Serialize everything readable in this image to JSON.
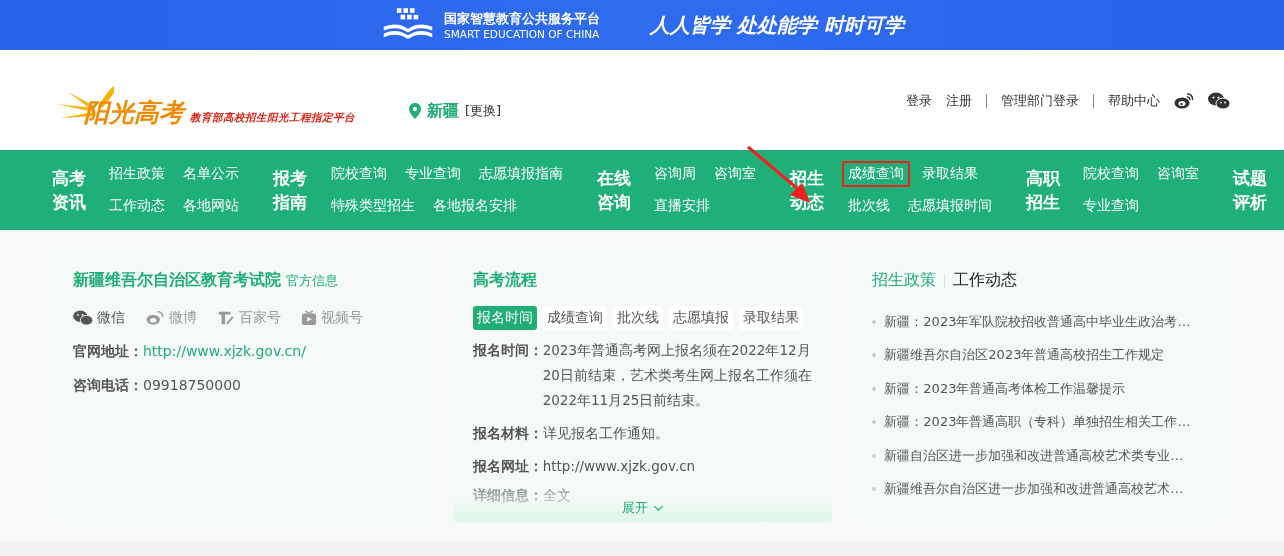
{
  "banner": {
    "platform_name": "国家智慧教育公共服务平台",
    "platform_name_en": "SMART EDUCATION OF CHINA",
    "slogan": "人人皆学 处处能学 时时可学"
  },
  "header": {
    "logo_text": "阳光高考",
    "logo_subtitle": "教育部高校招生阳光工程指定平台",
    "location": "新疆",
    "change_link": "[更换]",
    "link_groups": [
      [
        "登录",
        "注册"
      ],
      [
        "管理部门登录"
      ],
      [
        "帮助中心"
      ]
    ]
  },
  "nav": [
    {
      "title": "高考资讯",
      "rows": [
        [
          {
            "label": "招生政策",
            "highlighted": false
          },
          {
            "label": "名单公示",
            "highlighted": false
          }
        ],
        [
          {
            "label": "工作动态",
            "highlighted": false
          },
          {
            "label": "各地网站",
            "highlighted": false
          }
        ]
      ]
    },
    {
      "title": "报考指南",
      "rows": [
        [
          {
            "label": "院校查询",
            "highlighted": false
          },
          {
            "label": "专业查询",
            "highlighted": false
          },
          {
            "label": "志愿填报指南",
            "highlighted": false
          }
        ],
        [
          {
            "label": "特殊类型招生",
            "highlighted": false
          },
          {
            "label": "各地报名安排",
            "highlighted": false
          }
        ]
      ]
    },
    {
      "title": "在线咨询",
      "rows": [
        [
          {
            "label": "咨询周",
            "highlighted": false
          },
          {
            "label": "咨询室",
            "highlighted": false
          }
        ],
        [
          {
            "label": "直播安排",
            "highlighted": false
          }
        ]
      ]
    },
    {
      "title": "招生动态",
      "rows": [
        [
          {
            "label": "成绩查询",
            "highlighted": true
          },
          {
            "label": "录取结果",
            "highlighted": false
          }
        ],
        [
          {
            "label": "批次线",
            "highlighted": false
          },
          {
            "label": "志愿填报时间",
            "highlighted": false
          }
        ]
      ]
    },
    {
      "title": "高职招生",
      "rows": [
        [
          {
            "label": "院校查询",
            "highlighted": false
          },
          {
            "label": "咨询室",
            "highlighted": false
          }
        ],
        [
          {
            "label": "专业查询",
            "highlighted": false
          }
        ]
      ]
    },
    {
      "title": "试题评析"
    }
  ],
  "annotation_arrow": true,
  "institution_card": {
    "title": "新疆维吾尔自治区教育考试院",
    "badge": "官方信息",
    "socials": [
      {
        "kind": "wechat",
        "label": "微信"
      },
      {
        "kind": "weibo",
        "label": "微博"
      },
      {
        "kind": "baijiahao",
        "label": "百家号"
      },
      {
        "kind": "channels",
        "label": "视频号"
      }
    ],
    "fields": [
      {
        "label": "官网地址：",
        "value": "http://www.xjzk.gov.cn/",
        "kind": "link"
      },
      {
        "label": "咨询电话：",
        "value": "09918750000",
        "kind": "text"
      }
    ]
  },
  "process_card": {
    "title": "高考流程",
    "tabs": [
      {
        "label": "报名时间",
        "selected": true
      },
      {
        "label": "成绩查询",
        "selected": false
      },
      {
        "label": "批次线",
        "selected": false
      },
      {
        "label": "志愿填报",
        "selected": false
      },
      {
        "label": "录取结果",
        "selected": false
      }
    ],
    "fields": [
      {
        "label": "报名时间：",
        "value": "2023年普通高考网上报名须在2022年12月20日前结束，艺术类考生网上报名工作须在2022年11月25日前结束。",
        "faded": false
      },
      {
        "label": "报名材料：",
        "value": "详见报名工作通知。",
        "faded": false
      },
      {
        "label": "报名网址：",
        "value": "http://www.xjzk.gov.cn",
        "faded": false
      },
      {
        "label": "详细信息：",
        "value": "全文",
        "faded": true
      }
    ],
    "expand_label": "展开"
  },
  "news_card": {
    "tabs": [
      {
        "label": "招生政策",
        "selected": true
      },
      {
        "label": "工作动态",
        "selected": false
      }
    ],
    "items": [
      "新疆：2023年军队院校招收普通高中毕业生政治考…",
      "新疆维吾尔自治区2023年普通高校招生工作规定",
      "新疆：2023年普通高考体检工作温馨提示",
      "新疆：2023年普通高职（专科）单独招生相关工作…",
      "新疆自治区进一步加强和改进普通高校艺术类专业…",
      "新疆维吾尔自治区进一步加强和改进普通高校艺术…"
    ]
  }
}
